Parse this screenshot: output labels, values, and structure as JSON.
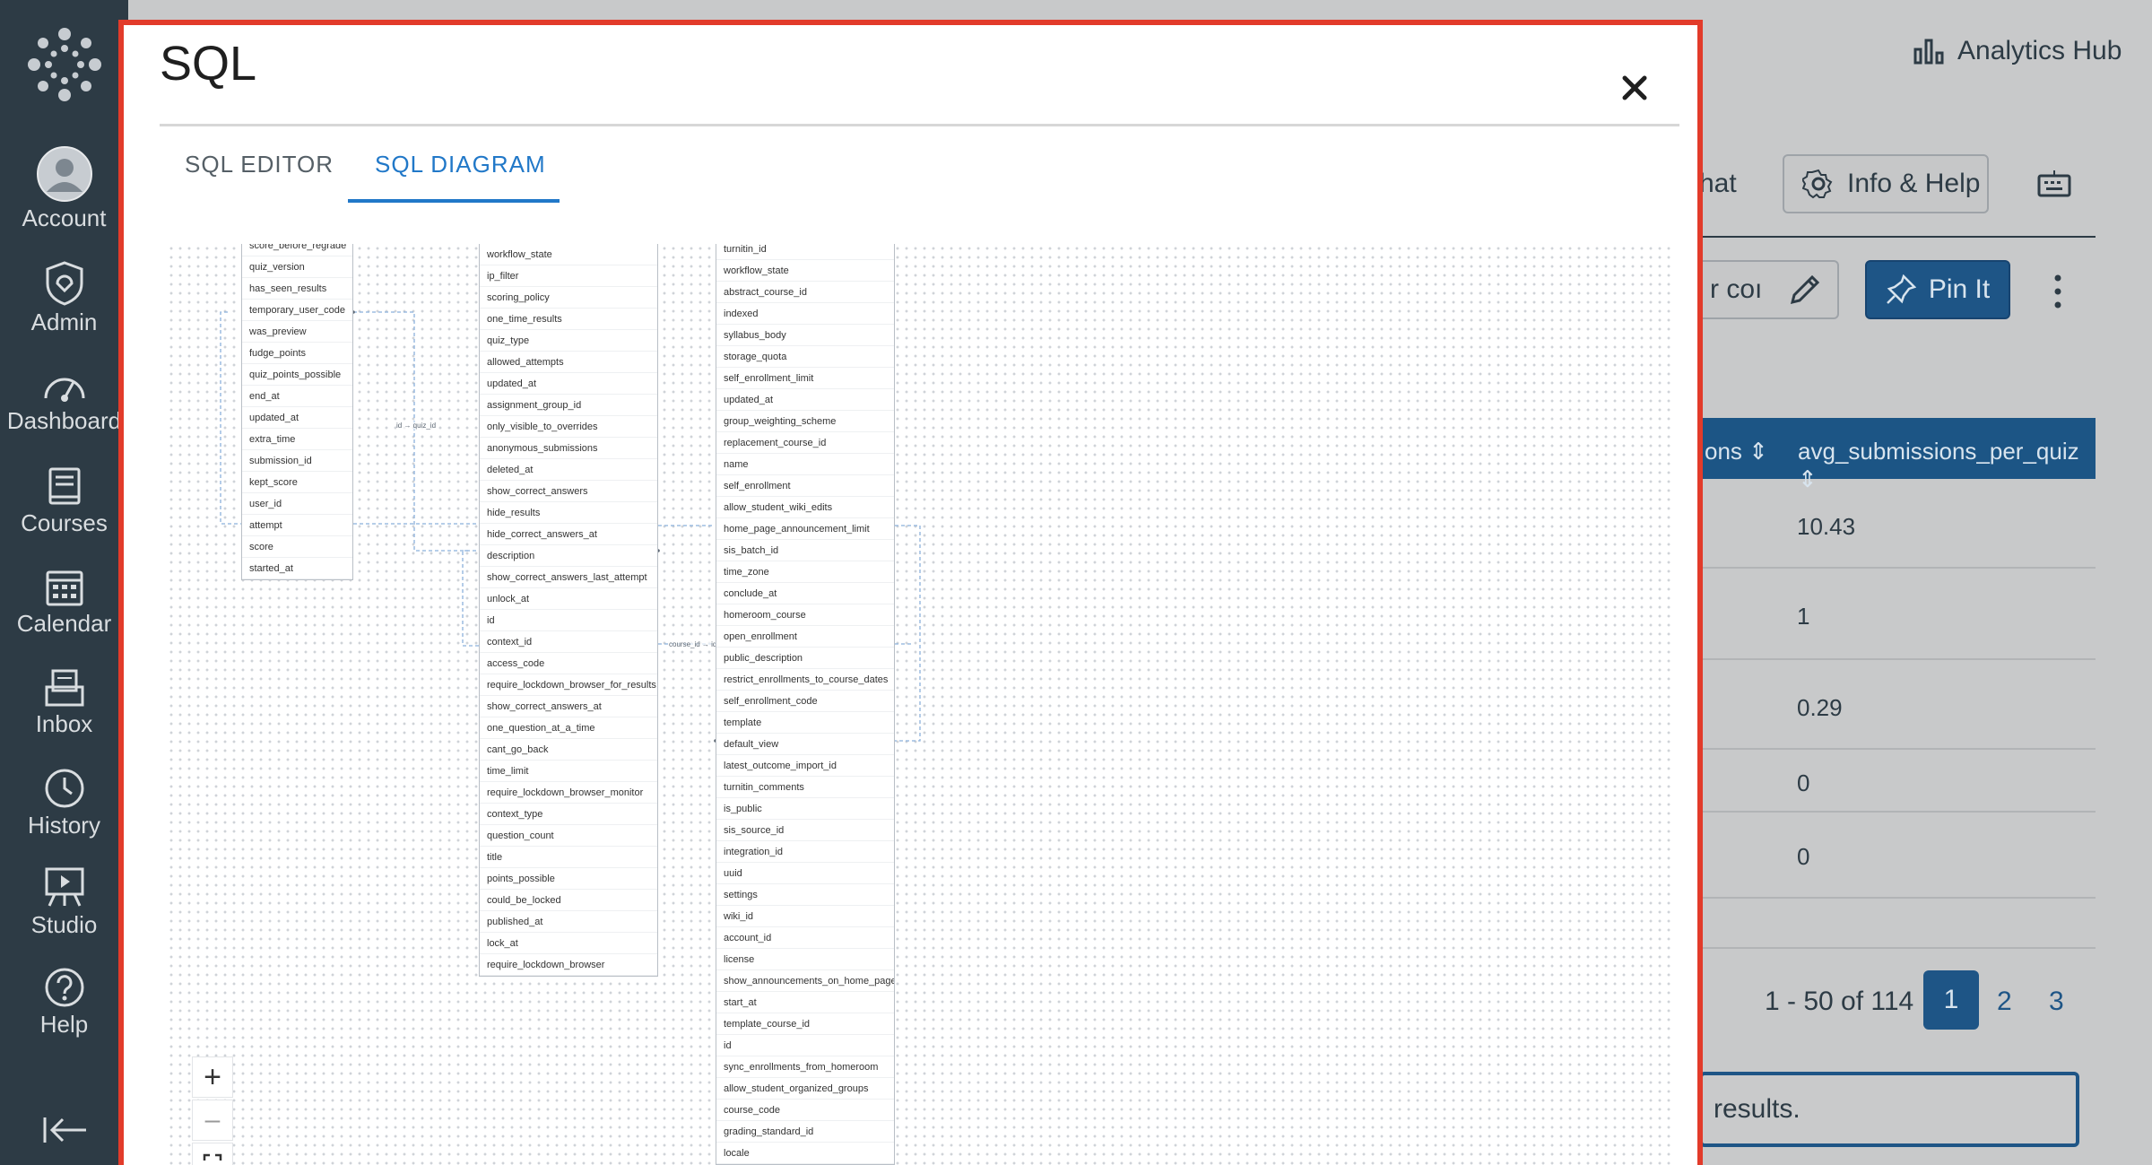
{
  "nav": {
    "items": [
      {
        "label": "Account",
        "icon": "account-icon"
      },
      {
        "label": "Admin",
        "icon": "admin-icon"
      },
      {
        "label": "Dashboard",
        "icon": "dashboard-icon"
      },
      {
        "label": "Courses",
        "icon": "courses-icon"
      },
      {
        "label": "Calendar",
        "icon": "calendar-icon"
      },
      {
        "label": "Inbox",
        "icon": "inbox-icon"
      },
      {
        "label": "History",
        "icon": "history-icon"
      },
      {
        "label": "Studio",
        "icon": "studio-icon"
      },
      {
        "label": "Help",
        "icon": "help-icon"
      }
    ]
  },
  "background": {
    "analytics_hub": "Analytics Hub",
    "chat_fragment": "hat",
    "info_help": "Info & Help",
    "input_fragment": "r coı",
    "pin_it": "Pin It",
    "col_fragment": "ons",
    "col_header": "avg_submissions_per_quiz",
    "rows": [
      "10.43",
      "1",
      "0.29",
      "0",
      "0"
    ],
    "range": "1 - 50 of 114",
    "pages": [
      "1",
      "2",
      "3"
    ],
    "results_fragment": "results."
  },
  "modal": {
    "title": "SQL",
    "tabs": {
      "editor": "SQL EDITOR",
      "diagram": "SQL DIAGRAM"
    },
    "active_tab": "SQL DIAGRAM",
    "edge_labels": {
      "quiz": "id → quiz_id",
      "course": "course_id → id"
    },
    "tables": {
      "submissions": [
        "score_before_regrade",
        "quiz_version",
        "has_seen_results",
        "temporary_user_code",
        "was_preview",
        "fudge_points",
        "quiz_points_possible",
        "end_at",
        "updated_at",
        "extra_time",
        "submission_id",
        "kept_score",
        "user_id",
        "attempt",
        "score",
        "started_at"
      ],
      "quizzes": [
        "workflow_state",
        "ip_filter",
        "scoring_policy",
        "one_time_results",
        "quiz_type",
        "allowed_attempts",
        "updated_at",
        "assignment_group_id",
        "only_visible_to_overrides",
        "anonymous_submissions",
        "deleted_at",
        "show_correct_answers",
        "hide_results",
        "hide_correct_answers_at",
        "description",
        "show_correct_answers_last_attempt",
        "unlock_at",
        "id",
        "context_id",
        "access_code",
        "require_lockdown_browser_for_results",
        "show_correct_answers_at",
        "one_question_at_a_time",
        "cant_go_back",
        "time_limit",
        "require_lockdown_browser_monitor",
        "context_type",
        "question_count",
        "title",
        "points_possible",
        "could_be_locked",
        "published_at",
        "lock_at",
        "require_lockdown_browser"
      ],
      "courses": [
        "turnitin_id",
        "workflow_state",
        "abstract_course_id",
        "indexed",
        "syllabus_body",
        "storage_quota",
        "self_enrollment_limit",
        "updated_at",
        "group_weighting_scheme",
        "replacement_course_id",
        "name",
        "self_enrollment",
        "allow_student_wiki_edits",
        "home_page_announcement_limit",
        "sis_batch_id",
        "time_zone",
        "conclude_at",
        "homeroom_course",
        "open_enrollment",
        "public_description",
        "restrict_enrollments_to_course_dates",
        "self_enrollment_code",
        "template",
        "default_view",
        "latest_outcome_import_id",
        "turnitin_comments",
        "is_public",
        "sis_source_id",
        "integration_id",
        "uuid",
        "settings",
        "wiki_id",
        "account_id",
        "license",
        "show_announcements_on_home_page",
        "start_at",
        "template_course_id",
        "id",
        "sync_enrollments_from_homeroom",
        "allow_student_organized_groups",
        "course_code",
        "grading_standard_id",
        "locale"
      ]
    },
    "zoom": {
      "in": "+",
      "out": "–"
    }
  }
}
